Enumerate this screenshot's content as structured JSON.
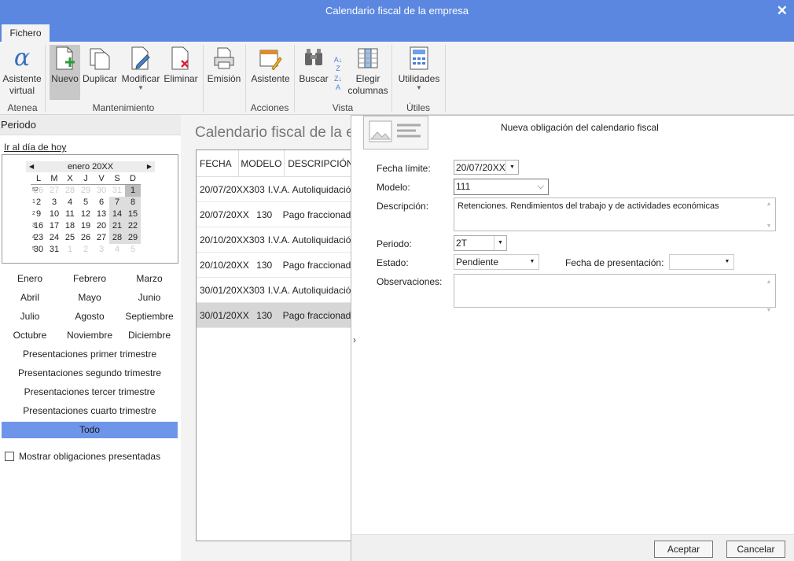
{
  "window": {
    "title": "Calendario fiscal de la empresa",
    "close": "✕"
  },
  "tabs": {
    "fichero": "Fichero"
  },
  "ribbon": {
    "asistente_virtual": "Asistente virtual",
    "nuevo": "Nuevo",
    "duplicar": "Duplicar",
    "modificar": "Modificar",
    "eliminar": "Eliminar",
    "emision": "Emisión",
    "asistente": "Asistente",
    "buscar": "Buscar",
    "elegir_columnas": "Elegir columnas",
    "utilidades": "Utilidades",
    "groups": {
      "atenea": "Atenea",
      "mantenimiento": "Mantenimiento",
      "acciones": "Acciones",
      "vista": "Vista",
      "utiles": "Útiles"
    }
  },
  "left": {
    "periodo": "Periodo",
    "hoy": "Ir al día de hoy",
    "calendar": {
      "month": "enero",
      "year": "20XX",
      "days": [
        "L",
        "M",
        "X",
        "J",
        "V",
        "S",
        "D"
      ],
      "weeks": [
        {
          "n": "52",
          "d": [
            "26",
            "27",
            "28",
            "29",
            "30",
            "31",
            "1"
          ]
        },
        {
          "n": "1",
          "d": [
            "2",
            "3",
            "4",
            "5",
            "6",
            "7",
            "8"
          ]
        },
        {
          "n": "2",
          "d": [
            "9",
            "10",
            "11",
            "12",
            "13",
            "14",
            "15"
          ]
        },
        {
          "n": "3",
          "d": [
            "16",
            "17",
            "18",
            "19",
            "20",
            "21",
            "22"
          ]
        },
        {
          "n": "4",
          "d": [
            "23",
            "24",
            "25",
            "26",
            "27",
            "28",
            "29"
          ]
        },
        {
          "n": "5",
          "d": [
            "30",
            "31",
            "1",
            "2",
            "3",
            "4",
            "5"
          ]
        }
      ]
    },
    "months": [
      "Enero",
      "Febrero",
      "Marzo",
      "Abril",
      "Mayo",
      "Junio",
      "Julio",
      "Agosto",
      "Septiembre",
      "Octubre",
      "Noviembre",
      "Diciembre"
    ],
    "presentaciones": [
      "Presentaciones primer trimestre",
      "Presentaciones segundo trimestre",
      "Presentaciones tercer trimestre",
      "Presentaciones cuarto trimestre"
    ],
    "todo": "Todo",
    "mostrar": "Mostrar obligaciones presentadas"
  },
  "main": {
    "title": "Calendario fiscal de la empresa",
    "columns": [
      "FECHA",
      "MODELO",
      "DESCRIPCIÓN"
    ],
    "rows": [
      {
        "fecha": "20/07/20XX",
        "modelo": "303",
        "desc": "I.V.A. Autoliquidación"
      },
      {
        "fecha": "20/07/20XX",
        "modelo": "130",
        "desc": "Pago fraccionado"
      },
      {
        "fecha": "20/10/20XX",
        "modelo": "303",
        "desc": "I.V.A. Autoliquidación"
      },
      {
        "fecha": "20/10/20XX",
        "modelo": "130",
        "desc": "Pago fraccionado"
      },
      {
        "fecha": "30/01/20XX",
        "modelo": "303",
        "desc": "I.V.A. Autoliquidación"
      },
      {
        "fecha": "30/01/20XX",
        "modelo": "130",
        "desc": "Pago fraccionado"
      }
    ]
  },
  "dialog": {
    "title": "Nueva obligación del calendario fiscal",
    "fecha_limite_label": "Fecha límite:",
    "fecha_limite": "20/07/20XX",
    "modelo_label": "Modelo:",
    "modelo": "111",
    "descripcion_label": "Descripción:",
    "descripcion": "Retenciones. Rendimientos del trabajo y de actividades económicas",
    "periodo_label": "Periodo:",
    "periodo": "2T",
    "estado_label": "Estado:",
    "estado": "Pendiente",
    "fecha_presentacion_label": "Fecha de presentación:",
    "fecha_presentacion": "",
    "observaciones_label": "Observaciones:",
    "observaciones": "",
    "aceptar": "Aceptar",
    "cancelar": "Cancelar"
  }
}
